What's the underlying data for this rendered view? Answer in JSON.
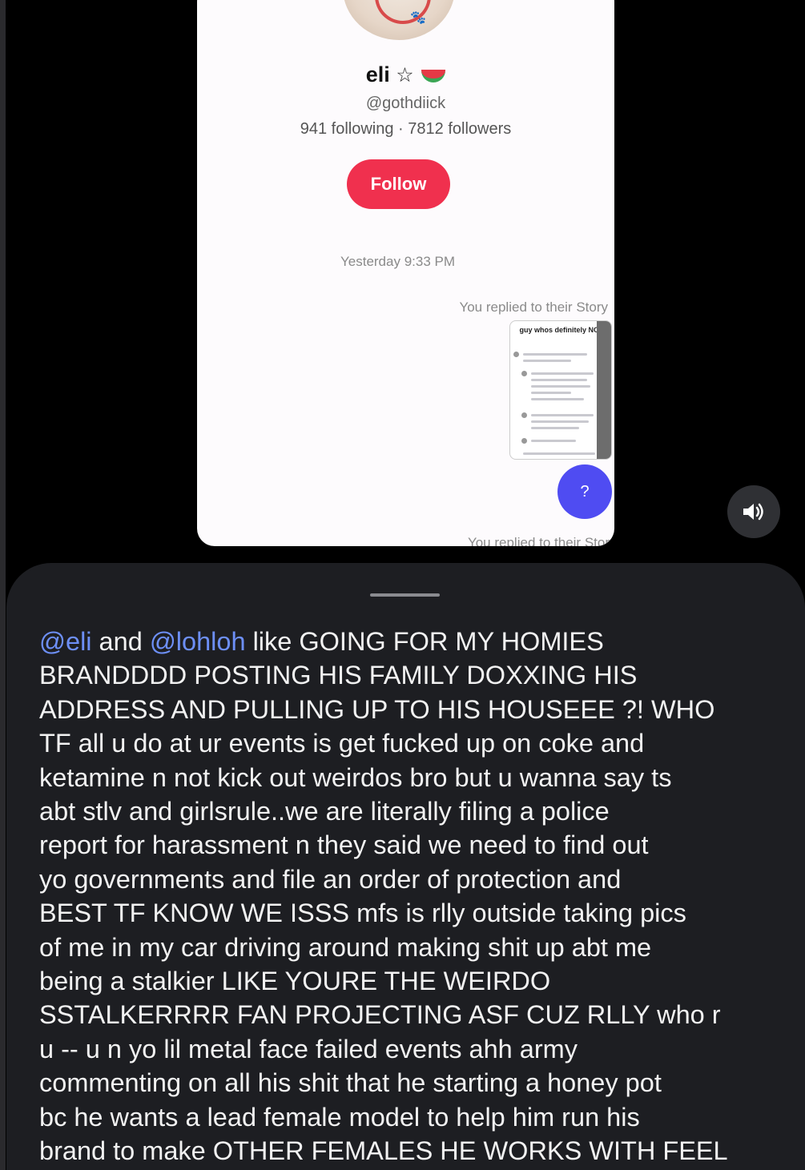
{
  "profile": {
    "name": "eli",
    "star_glyph": "☆",
    "handle": "@gothdiick",
    "stats": "941 following · 7812 followers",
    "follow_label": "Follow"
  },
  "chat": {
    "timestamp": "Yesterday 9:33 PM",
    "reply_note": "You replied to their Story",
    "reply_note_cut": "You replied to their Stor",
    "story_caption": "guy whos definitely NOT",
    "help_label": "?"
  },
  "icons": {
    "sound": "speaker-icon",
    "help": "question-icon"
  },
  "comment": {
    "mention_1": "@eli",
    "joiner": " and ",
    "mention_2": "@lohloh",
    "lines": [
      " like GOING FOR MY HOMIES",
      "BRANDDDD POSTING HIS FAMILY DOXXING HIS",
      "ADDRESS AND PULLING UP TO HIS HOUSEEE ?! WHO",
      "TF all u do at ur events is get fucked up on coke and",
      "ketamine n not kick out weirdos bro but u wanna say ts",
      "abt stlv and girlsrule..we are literally filing a police",
      "report for harassment n they said we need to find out",
      "yo governments and file an order of protection and",
      "BEST TF KNOW WE ISSS mfs is rlly outside taking pics",
      "of me in my car driving around making shit up abt me",
      "being a stalkier LIKE YOURE THE WEIRDO",
      "SSTALKERRRR FAN PROJECTING ASF CUZ RLLY who r",
      "u -- u n yo lil metal face failed events ahh army",
      "commenting on all his shit that he starting a honey pot",
      "bc he wants a lead female model to help him run his",
      "brand to make OTHER FEMALES HE WORKS WITH FEEL"
    ]
  },
  "colors": {
    "follow": "#f0304e",
    "help": "#4f4cf2",
    "mention": "#6d8ff7",
    "sheet": "#1d1e22"
  }
}
